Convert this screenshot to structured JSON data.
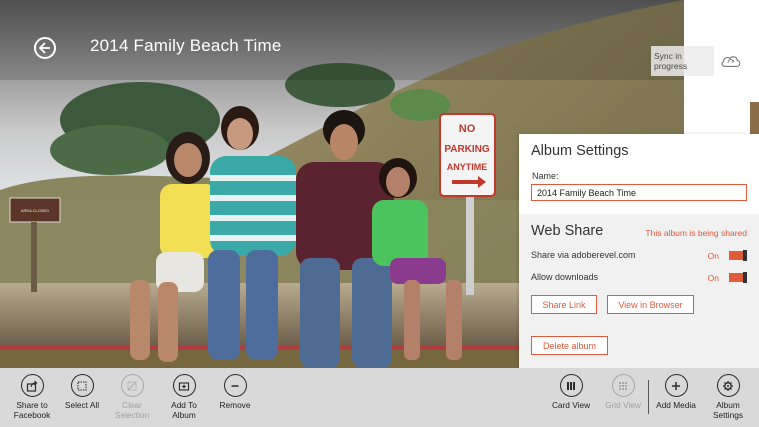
{
  "header": {
    "title": "2014 Family Beach Time"
  },
  "photo": {
    "sign_line1": "NO",
    "sign_line2": "PARKING",
    "sign_line3": "ANYTIME",
    "small_sign_text": "AREA CLOSED"
  },
  "sync": {
    "label": "Sync in progress",
    "icon": "cloud-sync-icon"
  },
  "settings": {
    "title": "Album Settings",
    "name_label": "Name:",
    "name_value": "2014 Family Beach Time",
    "web_share": {
      "title": "Web Share",
      "status": "This album is being shared",
      "share_via_label": "Share via adoberevel.com",
      "share_via_state": "On",
      "allow_downloads_label": "Allow downloads",
      "allow_downloads_state": "On",
      "share_link_button": "Share Link",
      "view_in_browser_button": "View in Browser",
      "delete_album_button": "Delete album"
    },
    "accent_color": "#e15a3a"
  },
  "app_bar": {
    "left": [
      {
        "label": "Share to Facebook",
        "icon": "share-icon",
        "enabled": true
      },
      {
        "label": "Select All",
        "icon": "select-all-icon",
        "enabled": true
      },
      {
        "label": "Clear Selection",
        "icon": "clear-selection-icon",
        "enabled": false
      },
      {
        "label": "Add To Album",
        "icon": "add-to-album-icon",
        "enabled": true
      },
      {
        "label": "Remove",
        "icon": "minus-icon",
        "enabled": true
      }
    ],
    "right": [
      {
        "label": "Card View",
        "icon": "card-view-icon",
        "enabled": true
      },
      {
        "label": "Grid View",
        "icon": "grid-view-icon",
        "enabled": false
      },
      {
        "label": "Add Media",
        "icon": "plus-icon",
        "enabled": true
      },
      {
        "label": "Album Settings",
        "icon": "gear-icon",
        "enabled": true
      }
    ]
  }
}
